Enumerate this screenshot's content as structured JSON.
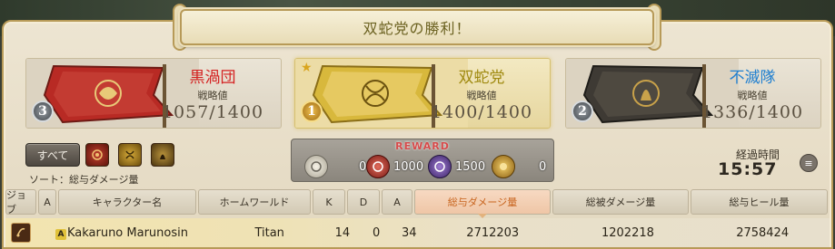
{
  "title": "双蛇党の勝利！",
  "teams": [
    {
      "name": "黒渦団",
      "name_color": "#d42020",
      "score_label": "戦略値",
      "score": "1057/1400",
      "rank": "3",
      "winner": false
    },
    {
      "name": "双蛇党",
      "name_color": "#a08a10",
      "score_label": "戦略値",
      "score": "1400/1400",
      "rank": "1",
      "winner": true
    },
    {
      "name": "不滅隊",
      "name_color": "#1f7fd0",
      "score_label": "戦略値",
      "score": "1336/1400",
      "rank": "2",
      "winner": false
    }
  ],
  "filters": {
    "all_label": "すべて",
    "sort_label": "ソート：総与ダメージ量",
    "icons": [
      "maelstrom-emblem-icon",
      "twin-adder-emblem-icon",
      "immortal-flames-emblem-icon"
    ]
  },
  "reward": {
    "title": "REWARD",
    "items": [
      {
        "icon": "wolf-mark-icon",
        "value": "0",
        "color": "#d9d4c6"
      },
      {
        "icon": "red-seal-icon",
        "value": "1000",
        "color": "#b83a3a"
      },
      {
        "icon": "purple-seal-icon",
        "value": "1500",
        "color": "#6e4aa6"
      },
      {
        "icon": "gold-medal-icon",
        "value": "0",
        "color": "#d1a43a"
      }
    ]
  },
  "elapsed": {
    "label": "経過時間",
    "time": "15:57"
  },
  "table": {
    "headers": [
      "ジョブ",
      "A",
      "キャラクター名",
      "ホームワールド",
      "K",
      "D",
      "A",
      "総与ダメージ量",
      "総被ダメージ量",
      "総与ヒール量"
    ],
    "active_header": 7,
    "rows": [
      {
        "party_mark": "A",
        "name": "Kakaruno Marunosin",
        "world": "Titan",
        "k": "14",
        "d": "0",
        "a": "34",
        "damage_dealt": "2712203",
        "damage_taken": "1202218",
        "healing": "2758424"
      }
    ]
  },
  "colors": {
    "frame_border": "#b79a58",
    "accent": "#c8641e"
  }
}
